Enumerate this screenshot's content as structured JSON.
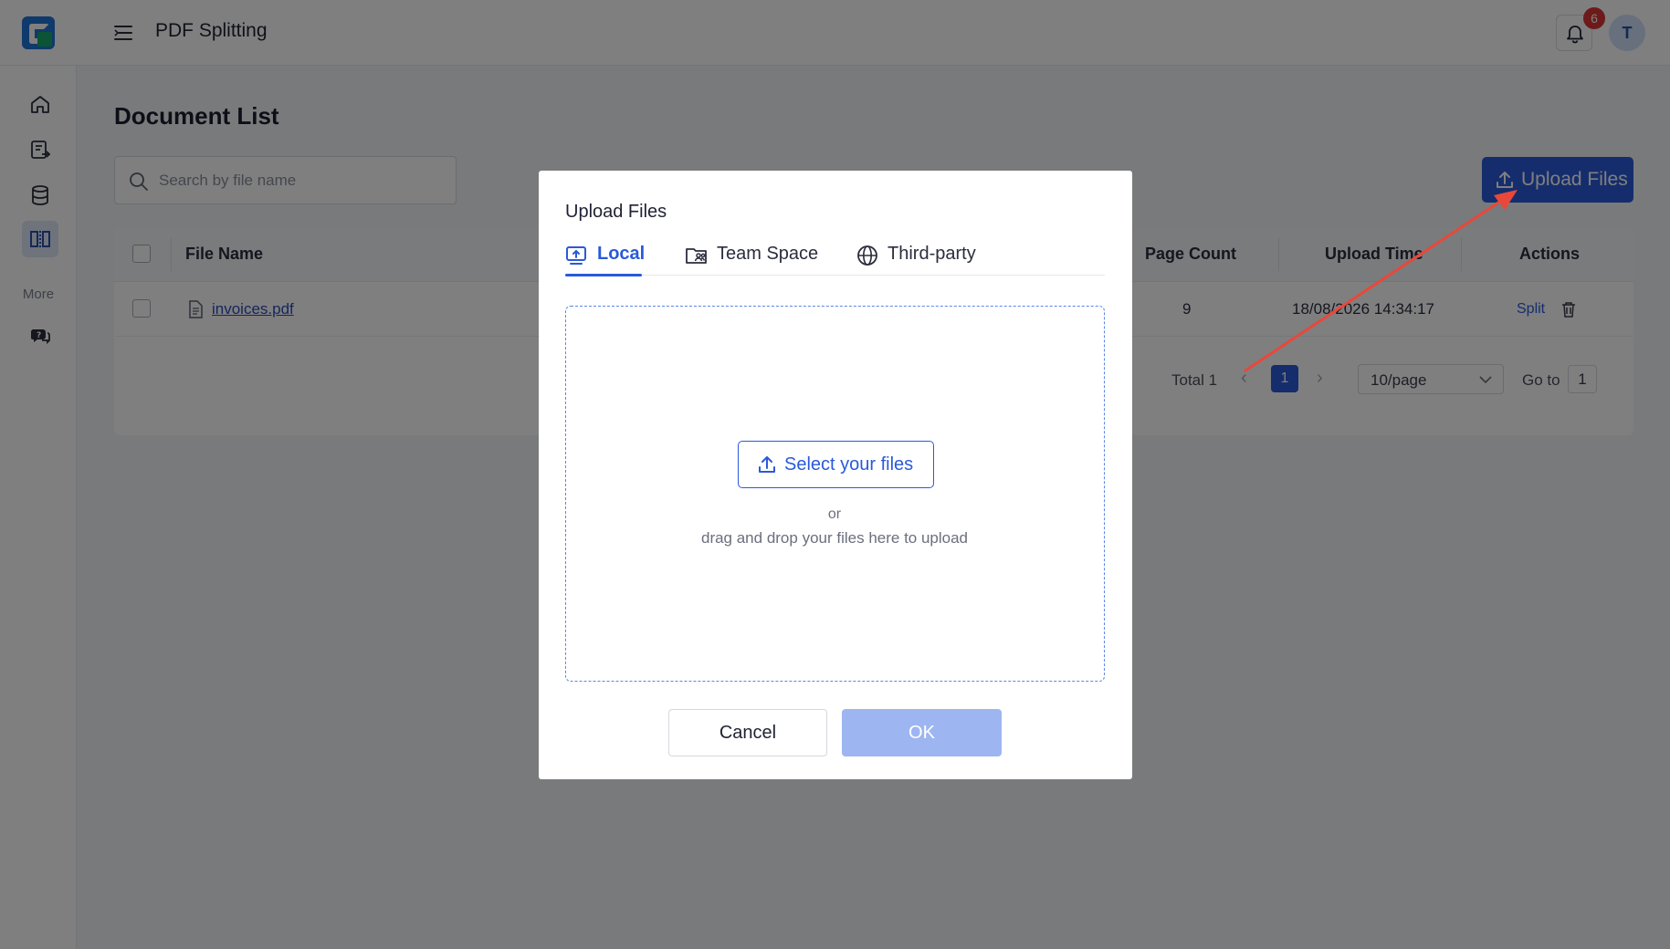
{
  "header": {
    "app_title": "PDF Splitting",
    "notification_count": "6",
    "avatar_initial": "T"
  },
  "sidebar": {
    "items": [
      {
        "icon": "home-icon"
      },
      {
        "icon": "document-export-icon"
      },
      {
        "icon": "database-icon"
      },
      {
        "icon": "split-columns-icon",
        "active": true
      }
    ],
    "more_label": "More",
    "more_items": [
      {
        "icon": "chat-support-icon"
      }
    ]
  },
  "main": {
    "page_title": "Document List",
    "search": {
      "placeholder": "Search by file name",
      "value": ""
    },
    "upload_button": "Upload Files",
    "table": {
      "columns": [
        "File Name",
        "Page Count",
        "Upload Time",
        "Actions"
      ],
      "rows": [
        {
          "file_name": "invoices.pdf",
          "page_count": "9",
          "upload_time": "18/08/2026 14:34:17",
          "action_split": "Split"
        }
      ]
    },
    "pagination": {
      "total": "Total 1",
      "current_page": "1",
      "page_size": "10/page",
      "goto_label": "Go to",
      "goto_value": "1"
    }
  },
  "modal": {
    "title": "Upload Files",
    "tabs": [
      {
        "label": "Local",
        "icon": "monitor-upload-icon",
        "active": true
      },
      {
        "label": "Team Space",
        "icon": "folder-team-icon",
        "active": false
      },
      {
        "label": "Third-party",
        "icon": "globe-icon",
        "active": false
      }
    ],
    "dropzone": {
      "select_button": "Select your files",
      "or_text": "or",
      "hint": "drag and drop your files here to upload"
    },
    "cancel_label": "Cancel",
    "ok_label": "OK"
  },
  "colors": {
    "accent": "#2a5ad9",
    "annotation_arrow": "#e8483a",
    "ok_disabled": "#9db6f1",
    "badge": "#d93434"
  }
}
